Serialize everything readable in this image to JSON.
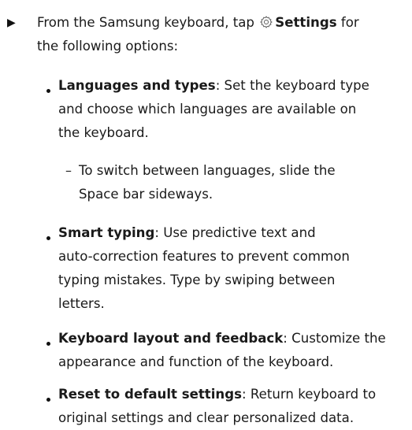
{
  "intro": {
    "before": "From the Samsung keyboard, tap",
    "settings_label": "Settings",
    "after_line1": " for",
    "line2": "the following options:"
  },
  "options": [
    {
      "title": "Languages and types",
      "lines": [
        ": Set the keyboard type",
        "and choose which languages are available on",
        "the keyboard."
      ],
      "sub": {
        "lines": [
          "To switch between languages, slide the",
          "Space bar sideways."
        ]
      }
    },
    {
      "title": "Smart typing",
      "lines": [
        ": Use predictive text and",
        "auto-correction features to prevent common",
        "typing mistakes. Type by swiping between",
        "letters."
      ]
    },
    {
      "title": "Keyboard layout and feedback",
      "lines": [
        ": Customize the",
        "appearance and function of the keyboard."
      ]
    },
    {
      "title": "Reset to default settings",
      "lines": [
        ": Return keyboard to",
        "original settings and clear personalized data."
      ]
    }
  ],
  "icons": {
    "step_marker": "triangle-right-icon",
    "settings": "gear-icon"
  }
}
